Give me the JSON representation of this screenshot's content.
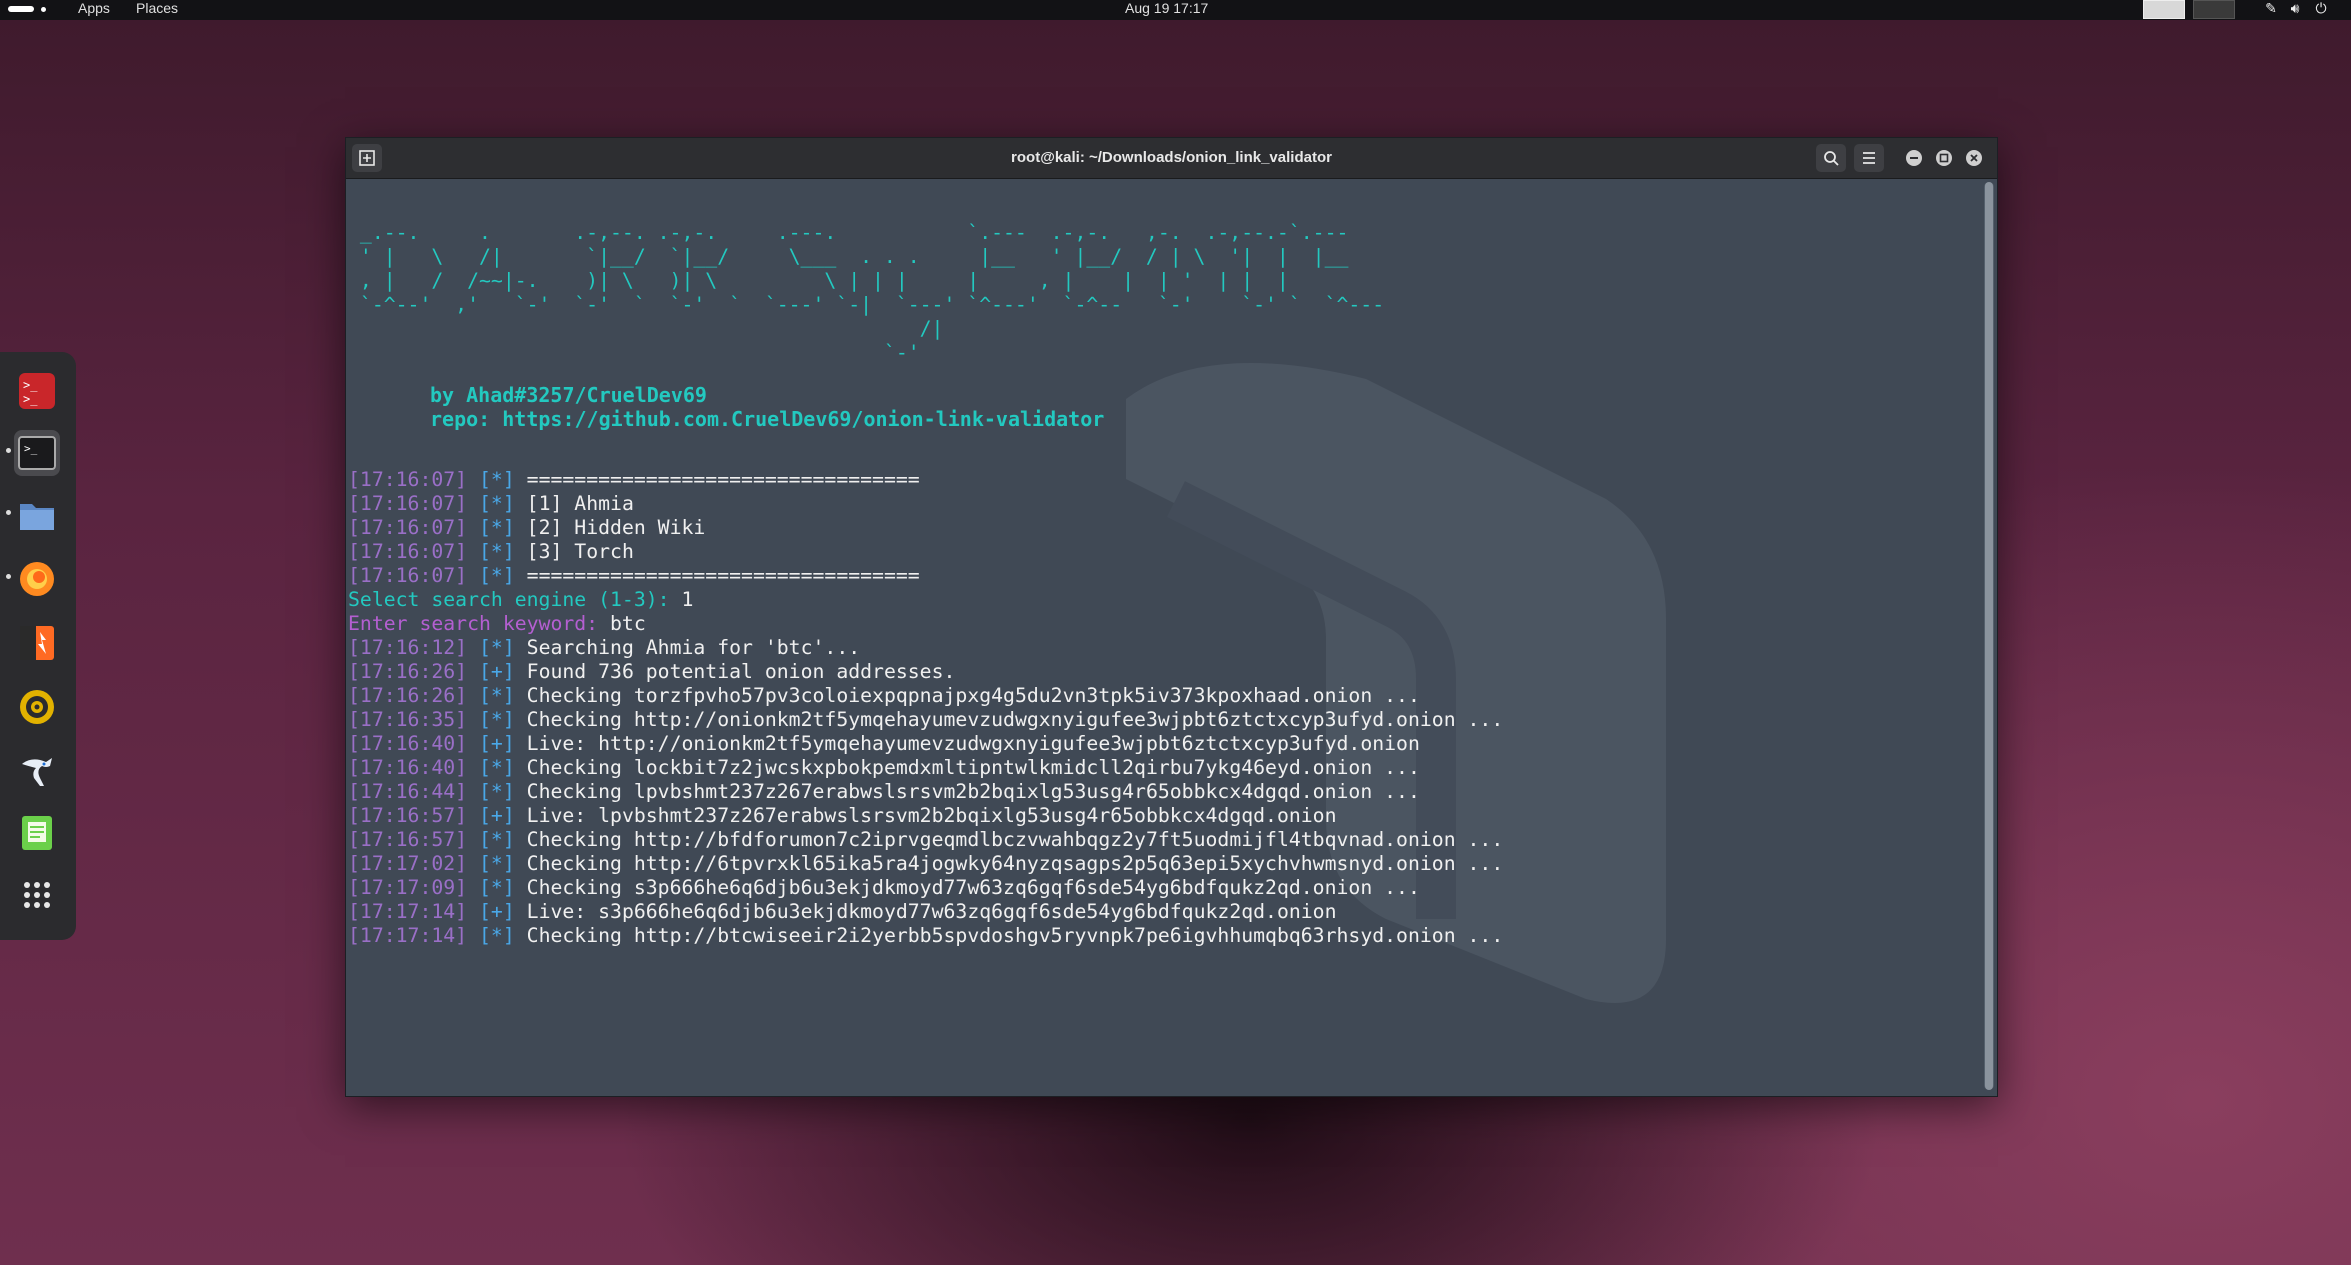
{
  "topbar": {
    "apps_label": "Apps",
    "places_label": "Places",
    "clock": "Aug 19  17:17"
  },
  "dash": {
    "items": [
      {
        "name": "Kali Terminal (root)",
        "icon": "root-terminal-icon"
      },
      {
        "name": "Terminal",
        "icon": "terminal-icon"
      },
      {
        "name": "Files",
        "icon": "folder-icon"
      },
      {
        "name": "Firefox",
        "icon": "firefox-icon"
      },
      {
        "name": "Burp Suite",
        "icon": "burpsuite-icon"
      },
      {
        "name": "Metasploit / radar",
        "icon": "radar-icon"
      },
      {
        "name": "Maltego",
        "icon": "kali-dragon-icon"
      },
      {
        "name": "Text Editor",
        "icon": "text-editor-icon"
      },
      {
        "name": "Show Apps",
        "icon": "app-grid-icon"
      }
    ]
  },
  "window": {
    "title": "root@kali: ~/Downloads/onion_link_validator"
  },
  "terminal": {
    "banner_lines": [
      " _.--.     .       .-,--. .-,-.     .---.           `.---  .-,-.   ,-.  .-,--.-`.---",
      " ' |   \\   /|       `|__/  `|__/     \\___  . . .     |__   ' |__/  / | \\  '|  |  |__ ",
      " , |   /  /~~|-.    )| \\   )| \\         \\ | | |     |     , |    |  | '  | |  |    ",
      " `-^--'  ,'   `-'  `-'  `  `-'  `  `---' `-|  `---' `^---'  `-^--   `-'    `-' `  `^---",
      "                                                /|",
      "                                             `-' "
    ],
    "credit": "by Ahad#3257/CruelDev69",
    "repo": "repo: https://github.com.CruelDev69/onion-link-validator",
    "log": [
      {
        "ts": "[17:16:07]",
        "tag": "[*]",
        "msg": "================================="
      },
      {
        "ts": "[17:16:07]",
        "tag": "[*]",
        "msg": "[1] Ahmia"
      },
      {
        "ts": "[17:16:07]",
        "tag": "[*]",
        "msg": "[2] Hidden Wiki"
      },
      {
        "ts": "[17:16:07]",
        "tag": "[*]",
        "msg": "[3] Torch"
      },
      {
        "ts": "[17:16:07]",
        "tag": "[*]",
        "msg": "================================="
      },
      {
        "prompt": "Select search engine (1-3): ",
        "answer": "1",
        "kind": "engine"
      },
      {
        "prompt": "Enter search keyword: ",
        "answer": "btc",
        "kind": "keyword"
      },
      {
        "ts": "[17:16:12]",
        "tag": "[*]",
        "msg": "Searching Ahmia for 'btc'..."
      },
      {
        "ts": "[17:16:26]",
        "tag": "[+]",
        "msg": "Found 736 potential onion addresses."
      },
      {
        "ts": "[17:16:26]",
        "tag": "[*]",
        "msg": "Checking torzfpvho57pv3coloiexpqpnajpxg4g5du2vn3tpk5iv373kpoxhaad.onion ..."
      },
      {
        "ts": "[17:16:35]",
        "tag": "[*]",
        "msg": "Checking http://onionkm2tf5ymqehayumevzudwgxnyigufee3wjpbt6ztctxcyp3ufyd.onion ..."
      },
      {
        "ts": "[17:16:40]",
        "tag": "[+]",
        "msg": "Live: http://onionkm2tf5ymqehayumevzudwgxnyigufee3wjpbt6ztctxcyp3ufyd.onion"
      },
      {
        "ts": "[17:16:40]",
        "tag": "[*]",
        "msg": "Checking lockbit7z2jwcskxpbokpemdxmltipntwlkmidcll2qirbu7ykg46eyd.onion ..."
      },
      {
        "ts": "[17:16:44]",
        "tag": "[*]",
        "msg": "Checking lpvbshmt237z267erabwslsrsvm2b2bqixlg53usg4r65obbkcx4dgqd.onion ..."
      },
      {
        "ts": "[17:16:57]",
        "tag": "[+]",
        "msg": "Live: lpvbshmt237z267erabwslsrsvm2b2bqixlg53usg4r65obbkcx4dgqd.onion"
      },
      {
        "ts": "[17:16:57]",
        "tag": "[*]",
        "msg": "Checking http://bfdforumon7c2iprvgeqmdlbczvwahbqgz2y7ft5uodmijfl4tbqvnad.onion ..."
      },
      {
        "ts": "[17:17:02]",
        "tag": "[*]",
        "msg": "Checking http://6tpvrxkl65ika5ra4jogwky64nyzqsagps2p5q63epi5xychvhwmsnyd.onion ..."
      },
      {
        "ts": "[17:17:09]",
        "tag": "[*]",
        "msg": "Checking s3p666he6q6djb6u3ekjdkmoyd77w63zq6gqf6sde54yg6bdfqukz2qd.onion ..."
      },
      {
        "ts": "[17:17:14]",
        "tag": "[+]",
        "msg": "Live: s3p666he6q6djb6u3ekjdkmoyd77w63zq6gqf6sde54yg6bdfqukz2qd.onion"
      },
      {
        "ts": "[17:17:14]",
        "tag": "[*]",
        "msg": "Checking http://btcwiseeir2i2yerbb5spvdoshgv5ryvnpk7pe6igvhhumqbq63rhsyd.onion ..."
      }
    ]
  },
  "colors": {
    "terminal_bg": "#404955",
    "banner_cyan": "#23c9c0",
    "timestamp_purple": "#9a6fc7",
    "tag_blue": "#4aa8e8",
    "keyword_prompt_magenta": "#b45fd1"
  }
}
